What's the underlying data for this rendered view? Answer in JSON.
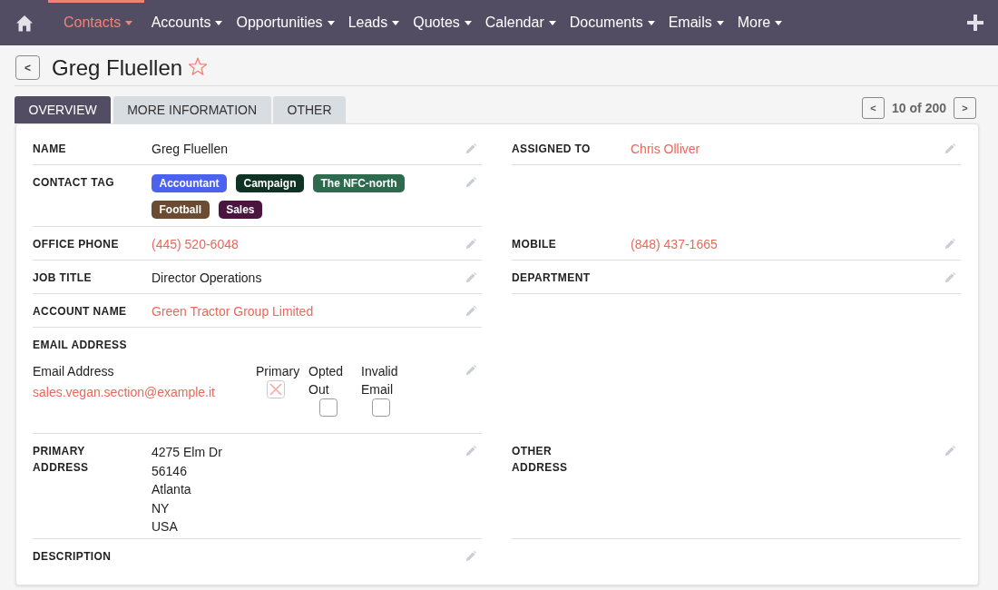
{
  "nav": {
    "items": [
      {
        "label": "Contacts",
        "selected": true
      },
      {
        "label": "Accounts",
        "selected": false
      },
      {
        "label": "Opportunities",
        "selected": false
      },
      {
        "label": "Leads",
        "selected": false
      },
      {
        "label": "Quotes",
        "selected": false
      },
      {
        "label": "Calendar",
        "selected": false
      },
      {
        "label": "Documents",
        "selected": false
      },
      {
        "label": "Emails",
        "selected": false
      },
      {
        "label": "More",
        "selected": false
      }
    ]
  },
  "record": {
    "back_button": "<",
    "title": "Greg Fluellen",
    "favorite": false
  },
  "tabs": [
    {
      "label": "OVERVIEW",
      "selected": true
    },
    {
      "label": "MORE INFORMATION",
      "selected": false
    },
    {
      "label": "OTHER",
      "selected": false
    }
  ],
  "pagination": {
    "previous": "<",
    "position": "10 of 200",
    "next": ">"
  },
  "rows": [
    {
      "left": {
        "kind": "text",
        "label": "NAME",
        "value": "Greg Fluellen"
      },
      "right": {
        "kind": "link",
        "label": "ASSIGNED TO",
        "value": "Chris Olliver"
      }
    },
    {
      "left": {
        "kind": "tags",
        "label": "CONTACT TAG",
        "tags": [
          {
            "label": "Accountant",
            "color": "#4a62ef"
          },
          {
            "label": "Campaign",
            "color": "#0e3325"
          },
          {
            "label": "The NFC-north",
            "color": "#2e6a4e"
          },
          {
            "label": "Football",
            "color": "#6b4b31"
          },
          {
            "label": "Sales",
            "color": "#4a163f"
          }
        ]
      }
    },
    {
      "left": {
        "kind": "link",
        "label": "OFFICE PHONE",
        "value": "(445) 520-6048"
      },
      "right": {
        "kind": "link",
        "label": "MOBILE",
        "value": "(848) 437-1665"
      }
    },
    {
      "left": {
        "kind": "text",
        "label": "JOB TITLE",
        "value": "Director Operations"
      },
      "right": {
        "kind": "text",
        "label": "DEPARTMENT"
      }
    },
    {
      "left": {
        "kind": "link",
        "label": "ACCOUNT NAME",
        "value": "Green Tractor Group Limited"
      }
    },
    {
      "left": {
        "kind": "email",
        "label": "EMAIL ADDRESS",
        "columns": [
          "Email Address",
          "Primary",
          "Opted Out",
          "Invalid Email"
        ],
        "emails": [
          {
            "address": "sales.vegan.section@example.it",
            "primary": true,
            "opted_out": false,
            "invalid": false
          }
        ]
      }
    },
    {
      "left": {
        "kind": "address",
        "label": "PRIMARY ADDRESS",
        "lines": [
          "4275 Elm Dr",
          "56146",
          "Atlanta",
          "NY",
          "USA"
        ]
      },
      "right": {
        "kind": "address",
        "label": "OTHER ADDRESS"
      }
    },
    {
      "left": {
        "kind": "text",
        "label": "DESCRIPTION"
      }
    }
  ]
}
